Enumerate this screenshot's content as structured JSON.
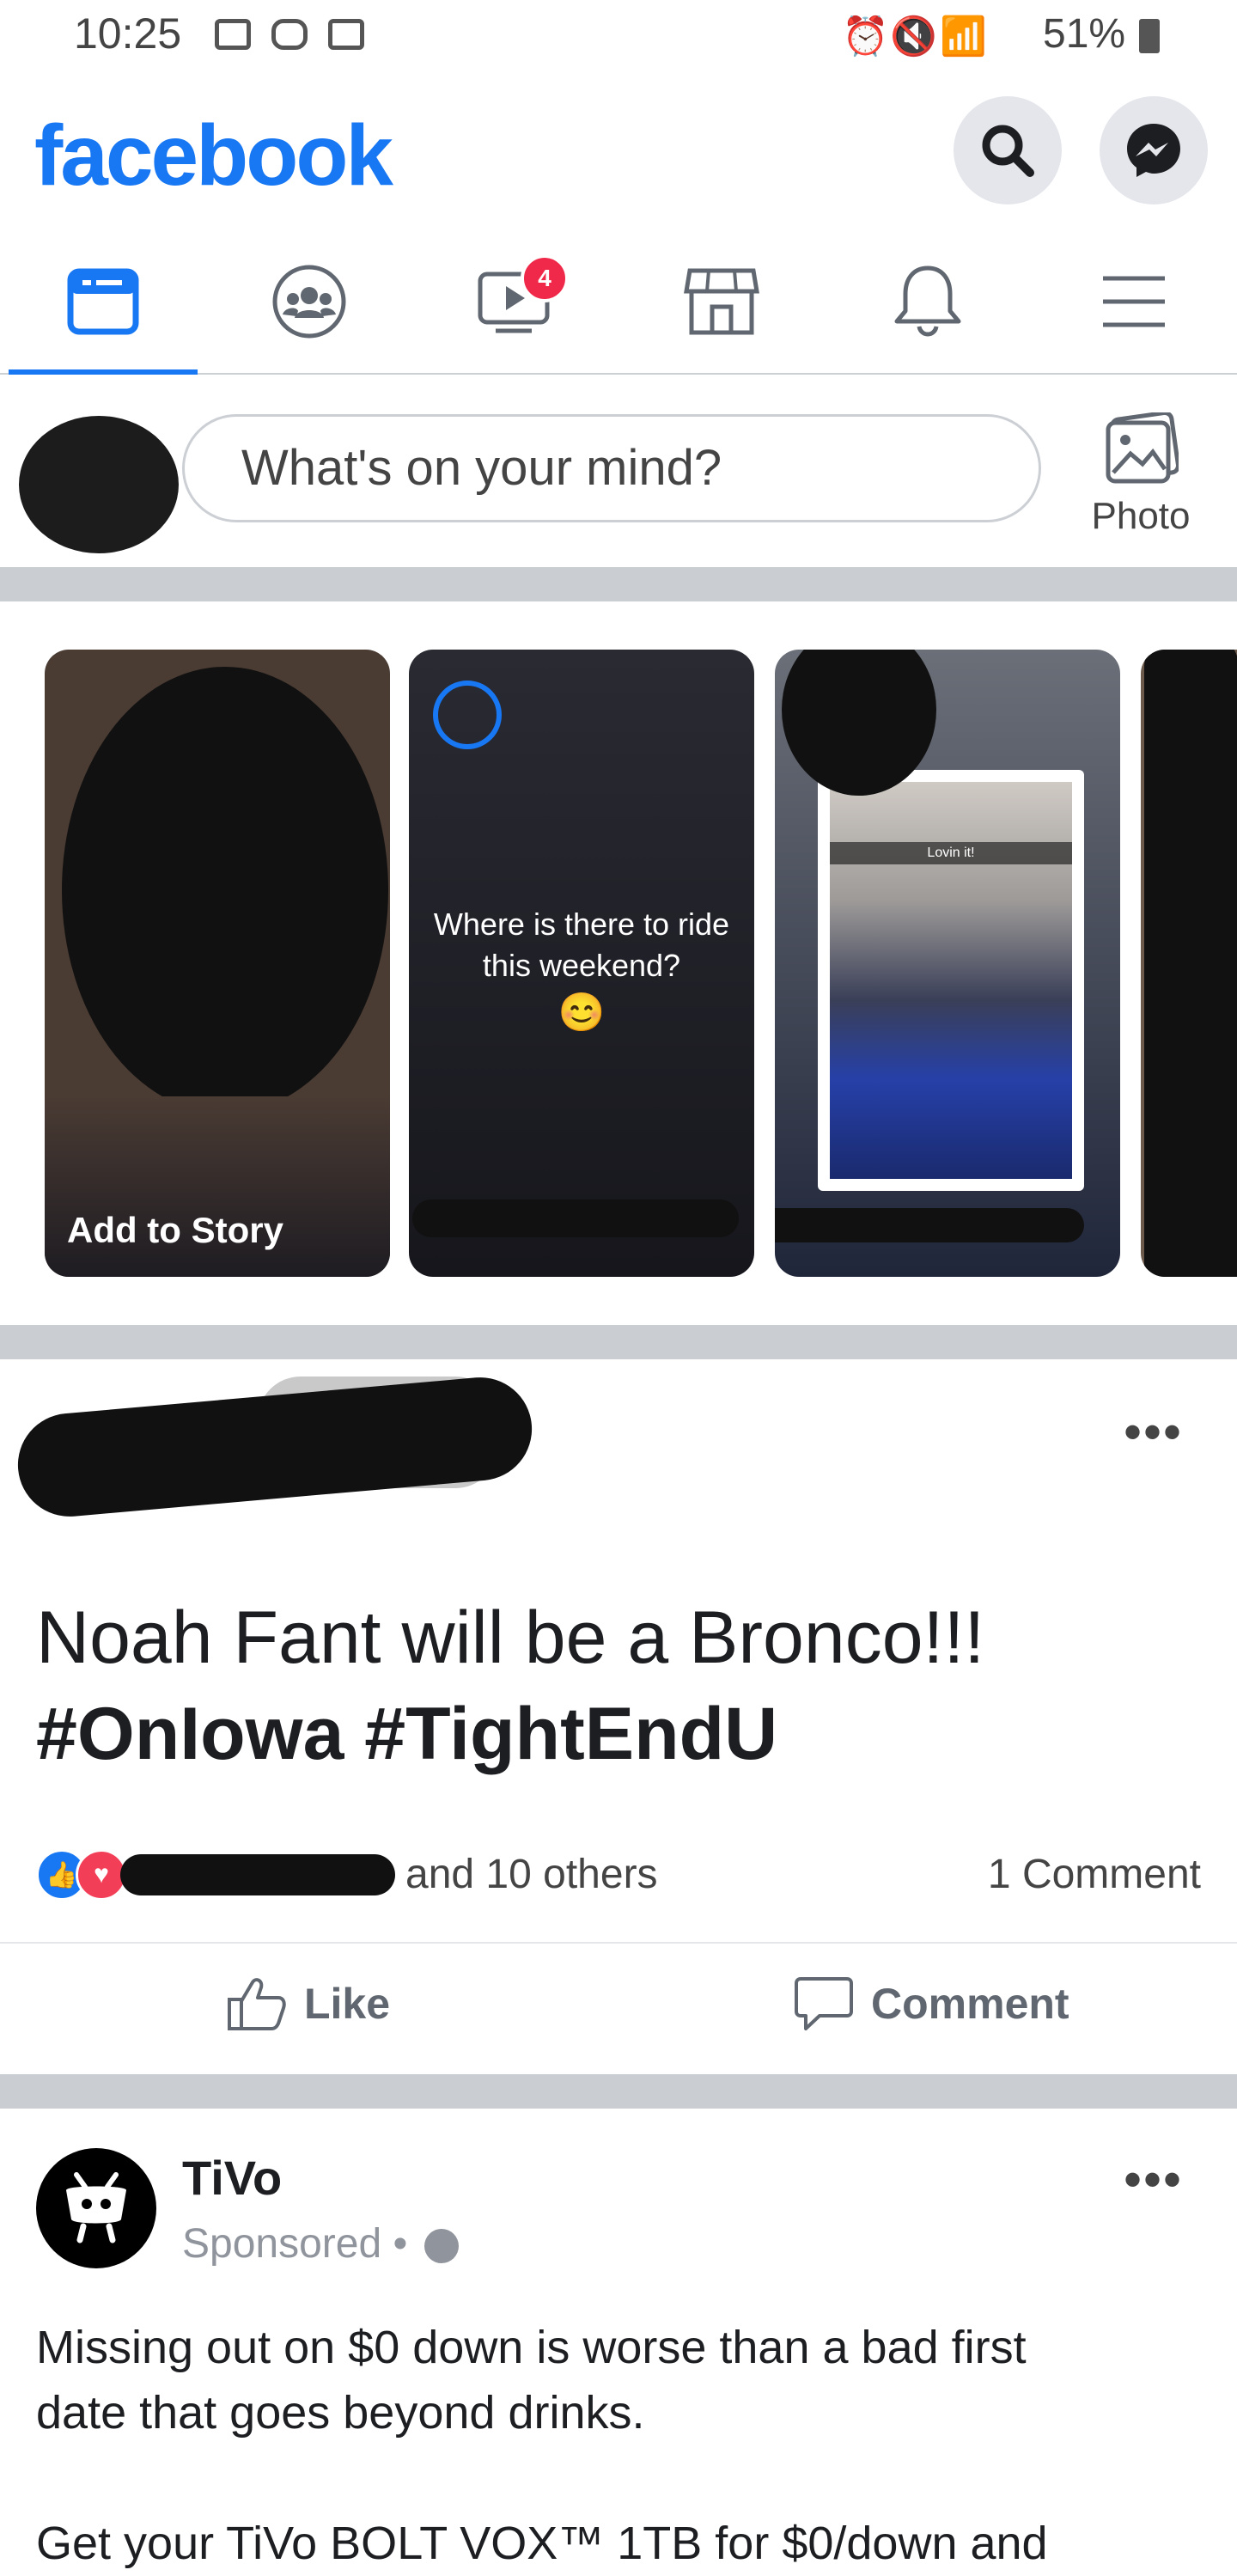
{
  "status_bar": {
    "time": "10:25",
    "battery": "51%"
  },
  "header": {
    "logo": "facebook",
    "search_icon": "search-icon",
    "messenger_icon": "messenger-icon"
  },
  "nav": {
    "items": [
      {
        "name": "news-feed",
        "icon": "feed-icon",
        "active": true
      },
      {
        "name": "groups",
        "icon": "groups-icon"
      },
      {
        "name": "watch",
        "icon": "watch-icon",
        "badge": "4"
      },
      {
        "name": "marketplace",
        "icon": "marketplace-icon"
      },
      {
        "name": "notifications",
        "icon": "bell-icon"
      },
      {
        "name": "menu",
        "icon": "hamburger-icon"
      }
    ],
    "accent": "#1877f2",
    "badge_color": "#f02849"
  },
  "composer": {
    "placeholder": "What's on your mind?",
    "photo_label": "Photo"
  },
  "stories": {
    "items": [
      {
        "label": "Add to Story"
      },
      {
        "text": "Where is there to ride this weekend?",
        "emoji": "😊"
      },
      {
        "caption": "Lovin it!"
      },
      {}
    ]
  },
  "post": {
    "text_light": "Noah Fant will be a Bronco!!!",
    "text_bold": "#OnIowa #TightEndU",
    "reactions": "and 10 others",
    "comments": "1 Comment",
    "like_label": "Like",
    "comment_label": "Comment"
  },
  "ad": {
    "name": "TiVo",
    "meta": "Sponsored •",
    "body_line1": "Missing out on $0 down is worse than a bad first",
    "body_line2": "date that goes beyond drinks.",
    "body_line3": "Get your TiVo BOLT VOX™ 1TB for $0/down and"
  }
}
